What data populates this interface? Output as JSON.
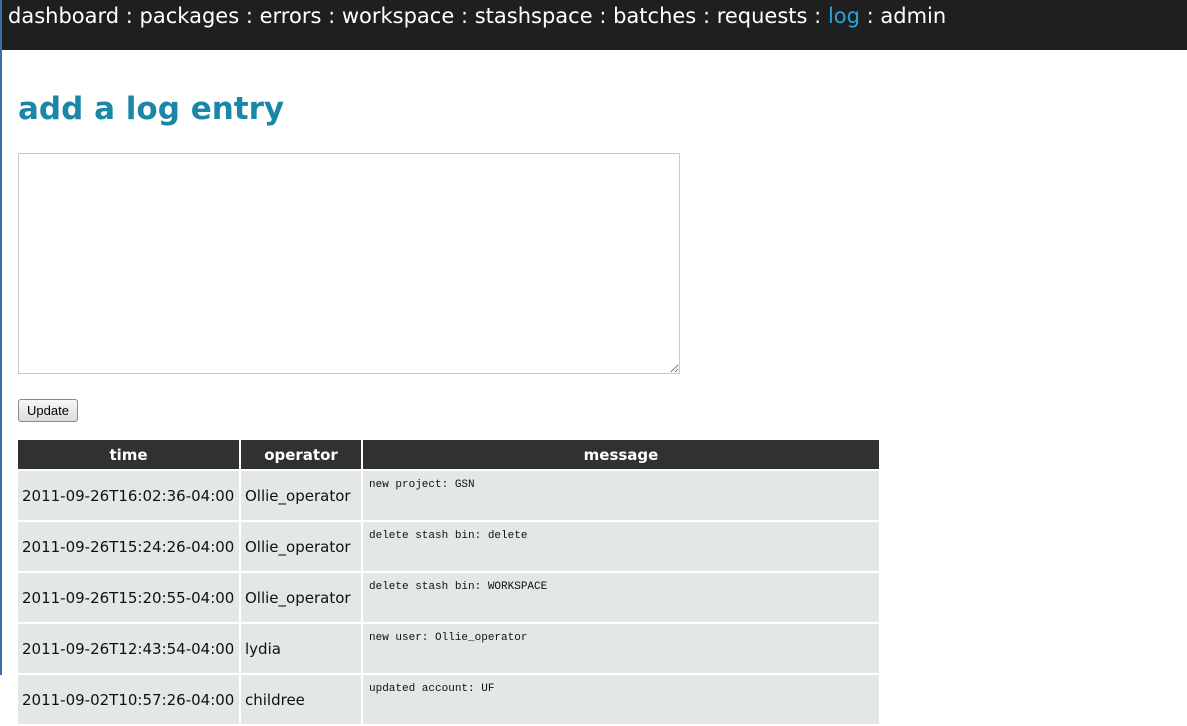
{
  "nav": {
    "items": [
      {
        "label": "dashboard",
        "active": false
      },
      {
        "label": "packages",
        "active": false
      },
      {
        "label": "errors",
        "active": false
      },
      {
        "label": "workspace",
        "active": false
      },
      {
        "label": "stashspace",
        "active": false
      },
      {
        "label": "batches",
        "active": false
      },
      {
        "label": "requests",
        "active": false
      },
      {
        "label": "log",
        "active": true
      },
      {
        "label": "admin",
        "active": false
      }
    ],
    "separator": ":"
  },
  "page": {
    "title": "add a log entry"
  },
  "form": {
    "entry_value": "",
    "update_label": "Update"
  },
  "table": {
    "headers": {
      "time": "time",
      "operator": "operator",
      "message": "message"
    },
    "rows": [
      {
        "time": "2011-09-26T16:02:36-04:00",
        "operator": "Ollie_operator",
        "message": "new project: GSN"
      },
      {
        "time": "2011-09-26T15:24:26-04:00",
        "operator": "Ollie_operator",
        "message": "delete stash bin: delete"
      },
      {
        "time": "2011-09-26T15:20:55-04:00",
        "operator": "Ollie_operator",
        "message": "delete stash bin: WORKSPACE"
      },
      {
        "time": "2011-09-26T12:43:54-04:00",
        "operator": "lydia",
        "message": "new user: Ollie_operator"
      },
      {
        "time": "2011-09-02T10:57:26-04:00",
        "operator": "childree",
        "message": "updated account: UF"
      }
    ]
  },
  "colors": {
    "nav_bg": "#1f1f1f",
    "nav_active": "#2aa3dd",
    "title": "#1a87a9",
    "table_header_bg": "#2f3133",
    "table_cell_bg": "#e3e8e4"
  }
}
